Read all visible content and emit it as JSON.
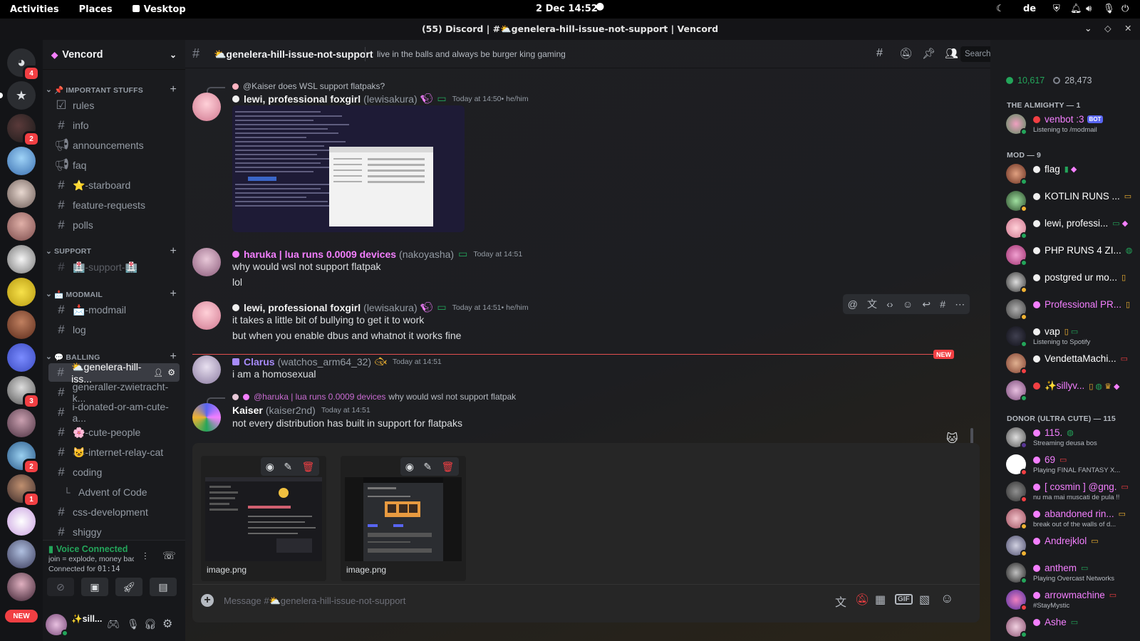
{
  "system_bar": {
    "activities": "Activities",
    "places": "Places",
    "app": "Vesktop",
    "datetime": "2 Dec  14:52",
    "keyboard": "de"
  },
  "window": {
    "title": "(55) Discord | #⛅genelera-hill-issue-not-support | Vencord"
  },
  "servers": {
    "home_badge": "4",
    "badges": [
      "2",
      "3",
      "2",
      "1"
    ],
    "new_label": "NEW"
  },
  "server": {
    "name": "Vencord"
  },
  "categories": [
    {
      "label": "📌 IMPORTANT STUFFS",
      "channels": [
        "rules",
        "info",
        "announcements",
        "faq",
        "⭐-starboard",
        "feature-requests",
        "polls"
      ]
    },
    {
      "label": "SUPPORT",
      "channels": [
        "🏥-support-🏥"
      ]
    },
    {
      "label": "📩 MODMAIL",
      "channels": [
        "📩-modmail",
        "log"
      ]
    },
    {
      "label": "💬 BALLING",
      "channels": [
        "⛅genelera-hill-iss...",
        "generaller-zwietracht-k...",
        "i-donated-or-am-cute-a...",
        "🌸-cute-people",
        "😺-internet-relay-cat",
        "coding",
        "Advent of Code",
        "css-development",
        "shiggy"
      ]
    }
  ],
  "voice": {
    "status": "Voice Connected",
    "channel": "join = explode, money back i...",
    "connected_label": "Connected for ",
    "duration": "01:14"
  },
  "user": {
    "name": "✨sill..."
  },
  "channel": {
    "name": "⛅genelera-hill-issue-not-support",
    "topic": "live in the balls and always be burger king gaming",
    "search_placeholder": "Search"
  },
  "messages": [
    {
      "reply": "@Kaiser does WSL support flatpaks?",
      "author": "lewi, professional foxgirl",
      "username": "(lewisakura)",
      "time": "Today at 14:50",
      "suffix": " • he/him",
      "color": "#f0f0f0"
    },
    {
      "author": "haruka | lua runs 0.0009 devices",
      "username": "(nakoyasha)",
      "time": "Today at 14:51",
      "lines": [
        "why would wsl not support flatpak",
        "lol"
      ],
      "color": "#f47fff"
    },
    {
      "author": "lewi, professional foxgirl",
      "username": "(lewisakura)",
      "time": "Today at 14:51",
      "suffix": " • he/him",
      "lines": [
        "it takes a little bit of bullying to get it to work",
        "but when you enable dbus and whatnot it works fine"
      ],
      "color": "#f0f0f0"
    },
    {
      "author": "Clarus",
      "username": "(watchos_arm64_32)",
      "time": "Today at 14:51",
      "lines": [
        "i am a homosexual"
      ],
      "color": "#a78bfa"
    },
    {
      "reply_author": "@haruka | lua runs 0.0009 devices",
      "reply": "why would wsl not support flatpak",
      "author": "Kaiser",
      "username": "(kaiser2nd)",
      "time": "Today at 14:51",
      "lines": [
        "not every distribution has built in support for flatpaks"
      ],
      "color": "#ffffff"
    }
  ],
  "new_label": "NEW",
  "attachments": [
    "image.png",
    "image.png"
  ],
  "composer": {
    "placeholder": "Message #⛅genelera-hill-issue-not-support"
  },
  "member_stats": {
    "online": "10,617",
    "total": "28,473"
  },
  "member_groups": [
    {
      "label": "THE ALMIGHTY — 1",
      "members": [
        {
          "name": "venbot :3",
          "bot": "BOT",
          "activity": "Listening to /modmail",
          "color": "#f47fff",
          "status": "#23a55a"
        }
      ]
    },
    {
      "label": "MOD — 9",
      "members": [
        {
          "name": "flag",
          "color": "#ffffff",
          "status": "#23a55a"
        },
        {
          "name": "KOTLIN RUNS ...",
          "color": "#ffffff",
          "status": "#f0b232"
        },
        {
          "name": "lewi, professi...",
          "color": "#ffffff",
          "status": "#23a55a"
        },
        {
          "name": "PHP RUNS 4 ZI...",
          "color": "#ffffff",
          "status": "#23a55a"
        },
        {
          "name": "postgred ur mo...",
          "color": "#ffffff",
          "status": "#f0b232"
        },
        {
          "name": "Professional PR...",
          "color": "#f47fff",
          "status": "#f0b232"
        },
        {
          "name": "vap",
          "activity": "Listening to Spotify",
          "color": "#ffffff",
          "status": "#23a55a"
        },
        {
          "name": "VendettaMachi...",
          "color": "#ffffff",
          "status": "#f23f43"
        },
        {
          "name": "✨sillyv...",
          "color": "#f47fff",
          "status": "#23a55a"
        }
      ]
    },
    {
      "label": "DONOR (ULTRA CUTE) — 115",
      "members": [
        {
          "name": "115.",
          "activity": "Streaming deusa bos",
          "color": "#f47fff",
          "status": "#593695"
        },
        {
          "name": "69",
          "activity": "Playing FINAL FANTASY X...",
          "color": "#f47fff",
          "status": "#f23f43"
        },
        {
          "name": "[ cosmin ] @gng.",
          "activity": "nu ma mai muscati de pula !!",
          "color": "#f47fff",
          "status": "#f23f43"
        },
        {
          "name": "abandoned rin...",
          "activity": "break out of the walls of d...",
          "color": "#f47fff",
          "status": "#f0b232"
        },
        {
          "name": "Andrejklol",
          "color": "#f47fff",
          "status": "#f0b232"
        },
        {
          "name": "anthem",
          "activity": "Playing Overcast Networks",
          "color": "#f47fff",
          "status": "#23a55a"
        },
        {
          "name": "arrowmachine",
          "activity": "#StayMystic",
          "color": "#f47fff",
          "status": "#f23f43"
        },
        {
          "name": "Ashe",
          "color": "#f47fff",
          "status": "#23a55a"
        }
      ]
    }
  ]
}
